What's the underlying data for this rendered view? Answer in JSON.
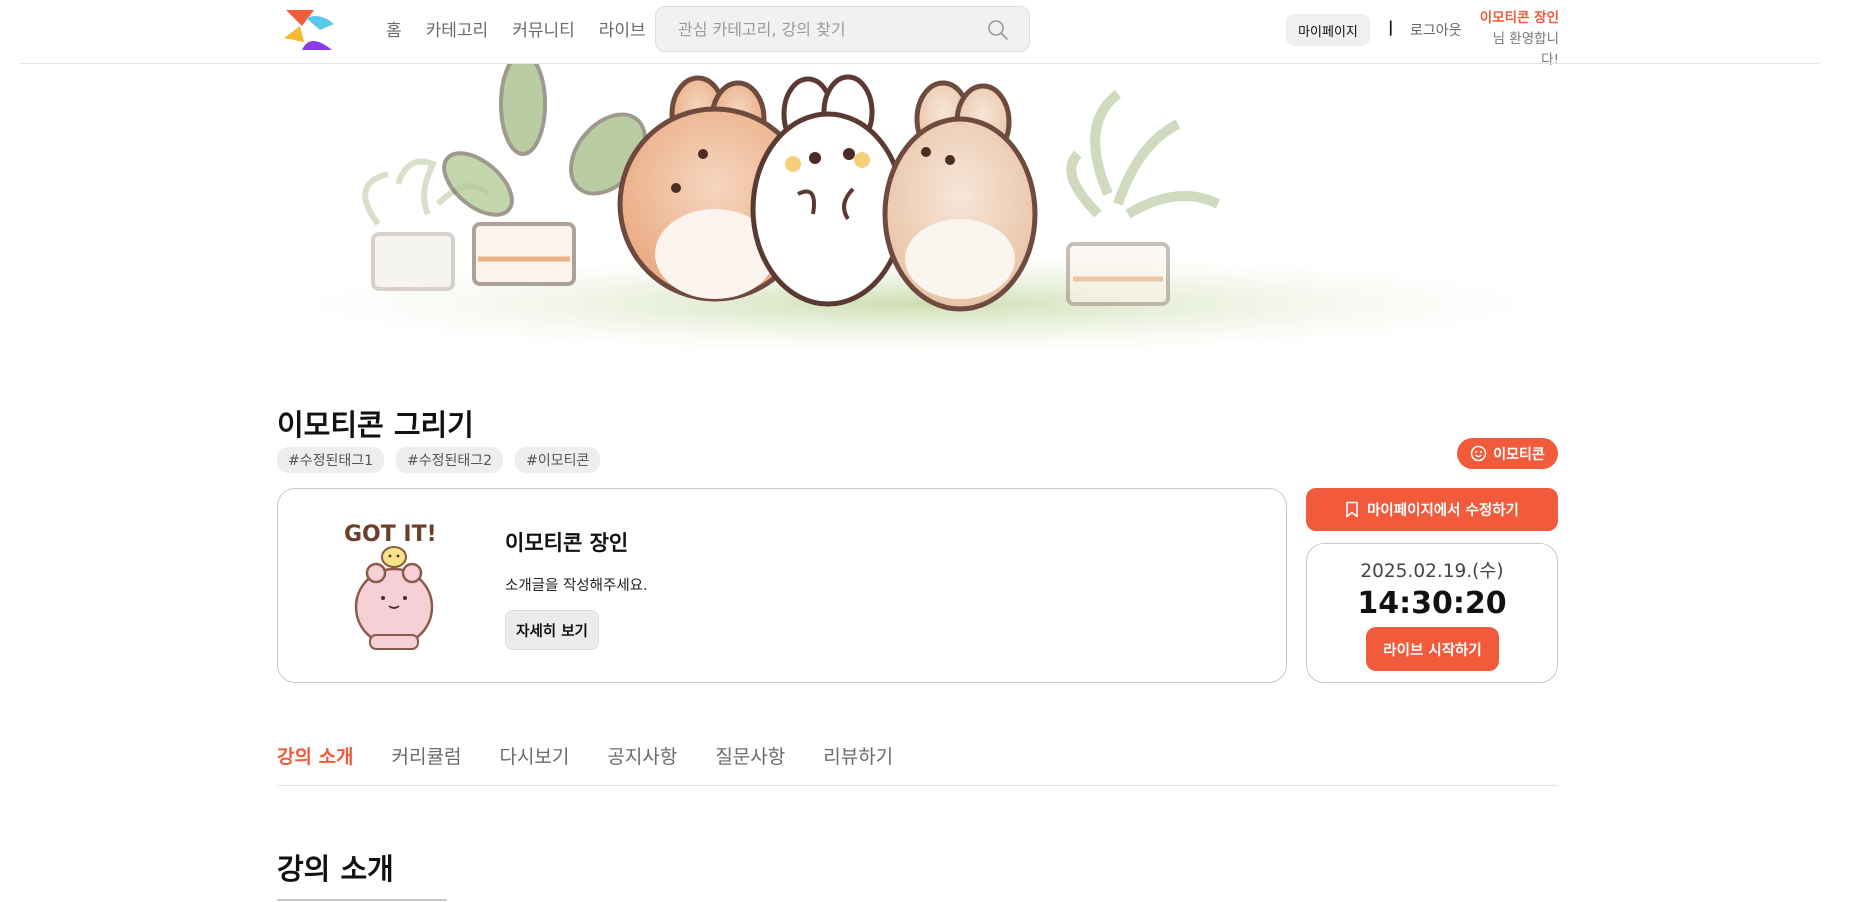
{
  "header": {
    "nav": [
      "홈",
      "카테고리",
      "커뮤니티",
      "라이브"
    ],
    "search_placeholder": "관심 카테고리, 강의 찾기",
    "mypage_label": "마이페이지",
    "divider": "|",
    "logout_label": "로그아웃",
    "user_name": "이모티콘 장인",
    "welcome_text": "님 환영합니다!"
  },
  "course": {
    "title": "이모티콘 그리기",
    "tags": [
      "#수정된태그1",
      "#수정된태그2",
      "#이모티콘"
    ],
    "category_badge": "이모티콘",
    "instructor": {
      "name": "이모티콘 장인",
      "intro": "소개글을 작성해주세요.",
      "detail_button": "자세히 보기"
    },
    "edit_button": "마이페이지에서 수정하기",
    "live": {
      "date": "2025.02.19.(수)",
      "time": "14:30:20",
      "start_button": "라이브 시작하기"
    }
  },
  "tabs": [
    "강의 소개",
    "커리큘럼",
    "다시보기",
    "공지사항",
    "질문사항",
    "리뷰하기"
  ],
  "active_tab": "강의 소개",
  "section": {
    "title": "강의 소개"
  },
  "colors": {
    "accent": "#f15a3b",
    "border": "#c9c9c9",
    "muted": "#6b6b6b"
  },
  "icons": [
    "logo-icon",
    "search-icon",
    "smile-icon",
    "bookmark-icon"
  ]
}
